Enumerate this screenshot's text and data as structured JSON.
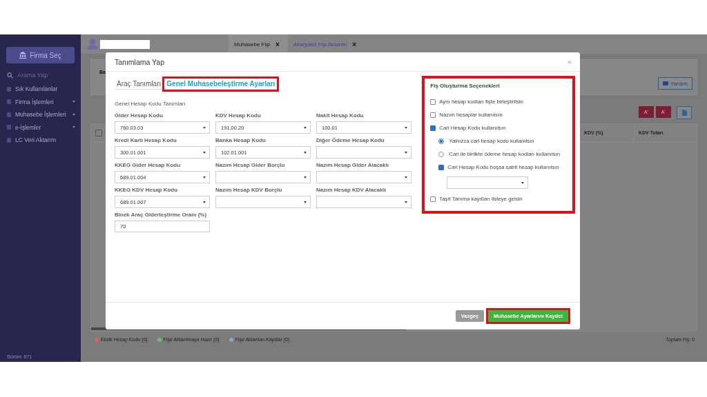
{
  "sidebar": {
    "company_button": "Firma Seç",
    "search": {
      "placeholder": "Arama Yap"
    },
    "items": [
      {
        "label": "Sık Kullanılanlar",
        "expandable": false
      },
      {
        "label": "Firma İşlemleri",
        "expandable": true
      },
      {
        "label": "Muhasebe İşlemleri",
        "expandable": true
      },
      {
        "label": "e-İşlemler",
        "expandable": true
      },
      {
        "label": "LC Veri Aktarım",
        "expandable": false
      }
    ],
    "version": "Sürüm: 671"
  },
  "header": {
    "tabs": [
      {
        "label": "Muhasebe Fişi",
        "close": "×",
        "selected": true
      },
      {
        "label": "Akaryakıt Fişi Aktarım",
        "close": "×",
        "selected": false
      }
    ]
  },
  "background": {
    "label_1": "Ba",
    "select_all_checked": false,
    "help_button": "Yardım",
    "font_buttons": [
      "A⁺",
      "A⁻"
    ],
    "columns": [
      "KDV (%)",
      "KDV Tutarı"
    ],
    "legend": [
      {
        "label": "Eksik Hesap Kodu (0)",
        "color": "#e06070"
      },
      {
        "label": "Fişe Aktarılmaya Hazır (0)",
        "color": "#70c070"
      },
      {
        "label": "Fişe Aktarılan Kayıtlar (0)",
        "color": "#80a8d8"
      }
    ],
    "total": "Toplam Fiş: 0"
  },
  "dialog": {
    "title": "Tanımlama Yap",
    "close": "×",
    "tabs": [
      {
        "label": "Araç Tanımları",
        "selected": false,
        "highlighted": false
      },
      {
        "label": "Genel Muhasebeleştirme Ayarları",
        "selected": true,
        "highlighted": true
      }
    ],
    "section_title": "Genel Hesap Kodu Tanımları",
    "fields": [
      {
        "label": "Gider Hesap Kodu",
        "value": "760.03.03"
      },
      {
        "label": "KDV Hesap Kodu",
        "value": "191.00.20"
      },
      {
        "label": "Nakit Hesap Kodu",
        "value": "100.01"
      },
      {
        "label": "Kredi Kartı Hesap Kodu",
        "value": "300.01.001"
      },
      {
        "label": "Banka Hesap Kodu",
        "value": "102.01.001"
      },
      {
        "label": "Diğer Ödeme Hesap Kodu"
      },
      {
        "label": "KKEG Gider Hesap Kodu",
        "value": "689.01.004"
      },
      {
        "label": "Nazım Hesap Gider Borçlu"
      },
      {
        "label": "Nazım Hesap Gider Alacaklı"
      },
      {
        "label": "KKEG KDV Hesap Kodu",
        "value": "689.01.007"
      },
      {
        "label": "Nazım Hesap KDV Borçlu"
      },
      {
        "label": "Nazım Hesap KDV Alacaklı"
      }
    ],
    "ratio": {
      "label": "Binek Araç Giderleştirme Oranı (%)",
      "value": "70"
    },
    "options": {
      "title": "Fiş Oluşturma Seçenekleri",
      "highlighted": true,
      "items": [
        {
          "kind": "checkbox",
          "label": "Aynı hesap kodları fişte birleştirilsin",
          "checked": false
        },
        {
          "kind": "checkbox",
          "label": "Nazım hesaplar kullanılsın",
          "checked": false
        },
        {
          "kind": "checkbox",
          "label": "Cari Hesap Kodu kullanılsın",
          "checked": true,
          "children": [
            {
              "kind": "radio",
              "label": "Yalnızca cari hesap kodu kullanılsın",
              "selected": true
            },
            {
              "kind": "radio",
              "label": "Cari ile birlikte ödeme hesap kodları kullanılsın",
              "selected": false
            },
            {
              "kind": "checkbox",
              "label": "Cari Hesap Kodu boşsa sabit hesap kullanılsın",
              "checked": true
            },
            {
              "kind": "select"
            }
          ]
        },
        {
          "kind": "checkbox",
          "label": "Taşıt Tanıma kayıtları listeye gelsin",
          "checked": false
        }
      ]
    },
    "cancel_button": "Vazgeç",
    "save_button": {
      "label": "Muhasebe Ayarlarını Kaydet",
      "highlighted": true
    }
  }
}
